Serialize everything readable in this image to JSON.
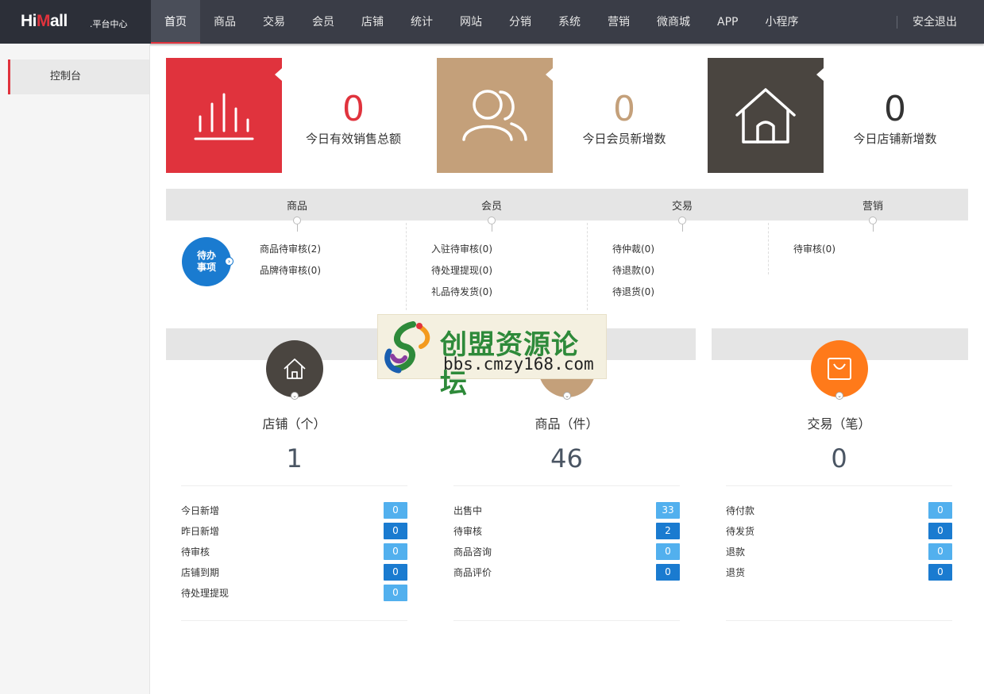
{
  "brand": {
    "logo_a": "Hi",
    "logo_b": "M",
    "logo_c": "all",
    "subtitle": ".平台中心"
  },
  "nav": {
    "items": [
      "首页",
      "商品",
      "交易",
      "会员",
      "店铺",
      "统计",
      "网站",
      "分销",
      "系统",
      "营销",
      "微商城",
      "APP",
      "小程序"
    ],
    "active_index": 0,
    "logout": "安全退出"
  },
  "sidebar": {
    "items": [
      {
        "label": "控制台"
      }
    ]
  },
  "stats": [
    {
      "value": "0",
      "label": "今日有效销售总额",
      "color": "#e0333d",
      "icon": "bar-chart-icon"
    },
    {
      "value": "0",
      "label": "今日会员新增数",
      "color": "#c4a07a",
      "icon": "users-icon"
    },
    {
      "value": "0",
      "label": "今日店铺新增数",
      "color": "#4a4540",
      "icon": "house-icon"
    }
  ],
  "todo": {
    "badge_line1": "待办",
    "badge_line2": "事项",
    "columns": [
      {
        "title": "商品",
        "items": [
          "商品待审核(2)",
          "品牌待审核(0)"
        ]
      },
      {
        "title": "会员",
        "items": [
          "入驻待审核(0)",
          "待处理提现(0)",
          "礼品待发货(0)"
        ]
      },
      {
        "title": "交易",
        "items": [
          "待仲裁(0)",
          "待退款(0)",
          "待退货(0)"
        ]
      },
      {
        "title": "营销",
        "items": [
          "待审核(0)"
        ]
      }
    ]
  },
  "panels": [
    {
      "title": "店铺（个）",
      "count": "1",
      "color": "#4a4540",
      "icon": "house-icon",
      "rows": [
        {
          "label": "今日新增",
          "value": "0"
        },
        {
          "label": "昨日新增",
          "value": "0"
        },
        {
          "label": "待审核",
          "value": "0"
        },
        {
          "label": "店铺到期",
          "value": "0"
        },
        {
          "label": "待处理提现",
          "value": "0"
        }
      ]
    },
    {
      "title": "商品（件）",
      "count": "46",
      "color": "#c4a07a",
      "icon": "goods-icon",
      "rows": [
        {
          "label": "出售中",
          "value": "33"
        },
        {
          "label": "待审核",
          "value": "2"
        },
        {
          "label": "商品咨询",
          "value": "0"
        },
        {
          "label": "商品评价",
          "value": "0"
        }
      ]
    },
    {
      "title": "交易（笔）",
      "count": "0",
      "color": "#ff7a1a",
      "icon": "bag-icon",
      "rows": [
        {
          "label": "待付款",
          "value": "0"
        },
        {
          "label": "待发货",
          "value": "0"
        },
        {
          "label": "退款",
          "value": "0"
        },
        {
          "label": "退货",
          "value": "0"
        }
      ]
    }
  ],
  "watermark": {
    "title": "创盟资源论坛",
    "url": "bbs.cmzy168.com"
  },
  "colors": {
    "nav_bg": "#3a3d47",
    "accent": "#e0333d",
    "badge_light": "#52b0ee",
    "badge_dark": "#1a7bd0"
  }
}
